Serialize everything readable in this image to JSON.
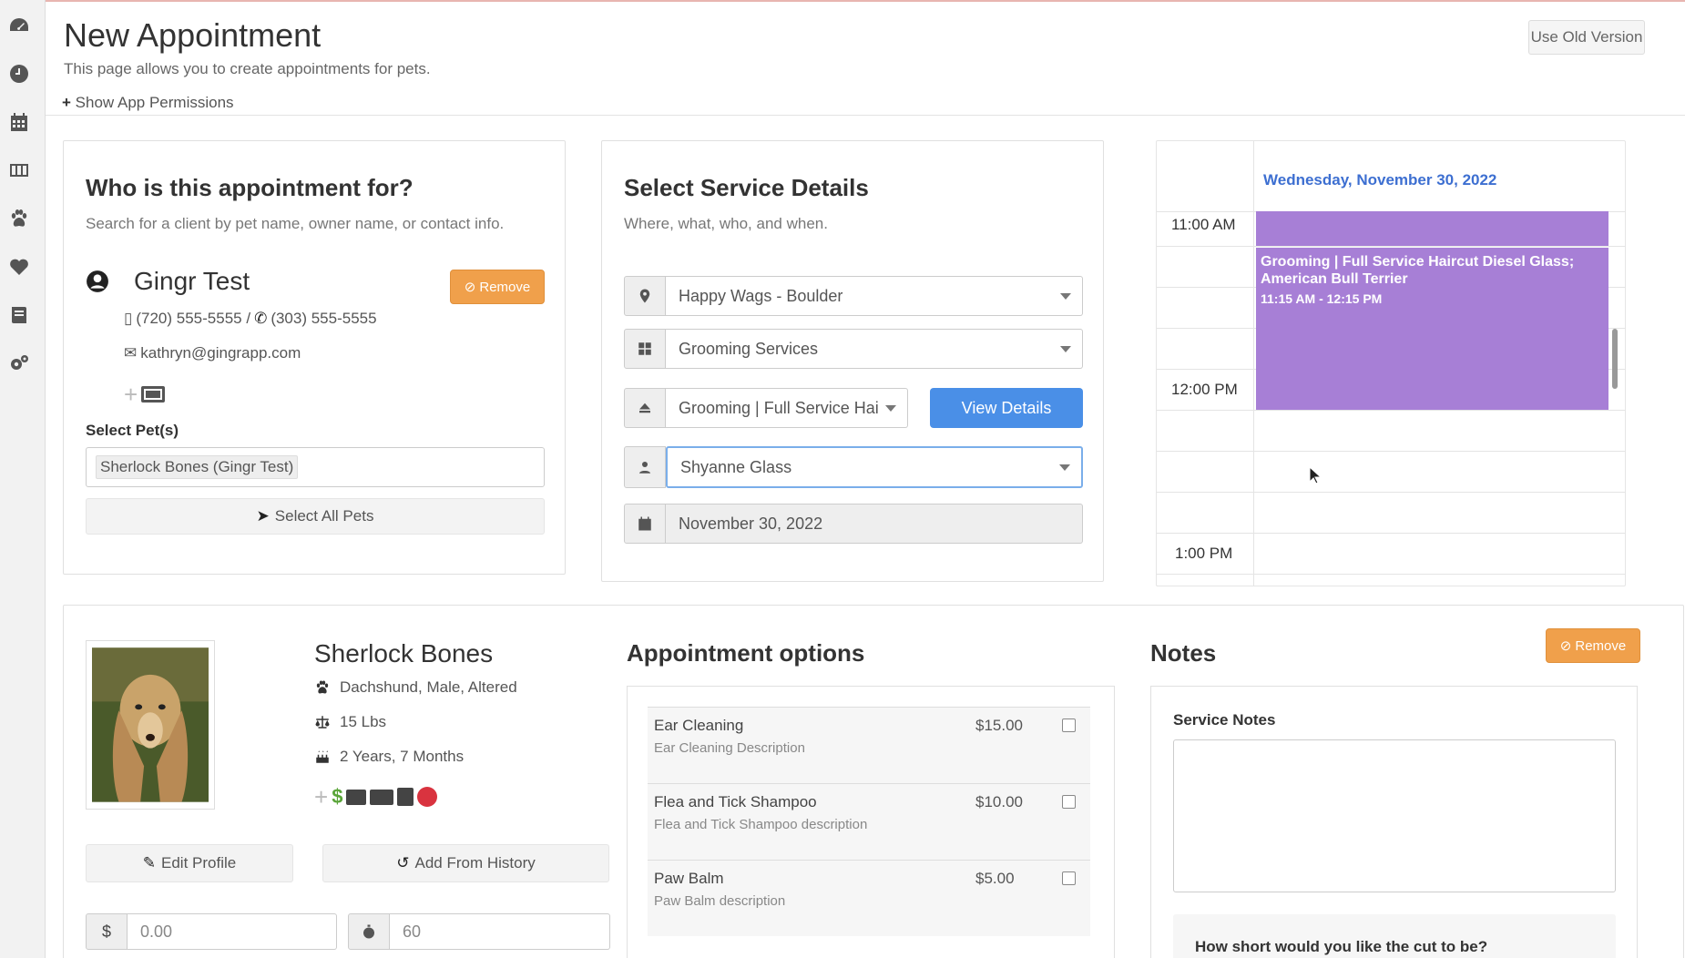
{
  "page": {
    "title": "New Appointment",
    "subtitle": "This page allows you to create appointments for pets.",
    "permissions_link": "Show App Permissions",
    "old_version_button": "Use Old Version"
  },
  "sidebar": {
    "icons": [
      "dashboard-icon",
      "clock-icon",
      "calendar-icon",
      "grid-icon",
      "paw-icon",
      "heart-icon",
      "book-icon",
      "gears-icon"
    ]
  },
  "client": {
    "heading": "Who is this appointment for?",
    "hint": "Search for a client by pet name, owner name, or contact info.",
    "name": "Gingr Test",
    "remove_label": "Remove",
    "phones": "(720) 555-5555 / ",
    "phone2": "(303) 555-5555",
    "email": "kathryn@gingrapp.com",
    "select_pets_label": "Select Pet(s)",
    "selected_pet": "Sherlock Bones (Gingr Test)",
    "select_all_label": "Select All Pets"
  },
  "service": {
    "heading": "Select Service Details",
    "hint": "Where, what, who, and when.",
    "location": "Happy Wags - Boulder",
    "category": "Grooming Services",
    "service": "Grooming | Full Service Hai",
    "view_details_label": "View Details",
    "staff": "Shyanne Glass",
    "date": "November 30, 2022"
  },
  "calendar": {
    "date_header": "Wednesday, November 30, 2022",
    "times": [
      "11:00 AM",
      "12:00 PM",
      "1:00 PM"
    ],
    "event_title": "Grooming | Full Service Haircut Diesel Glass; American Bull Terrier",
    "event_time": "11:15 AM - 12:15 PM",
    "event_color": "#a77fd6"
  },
  "pet": {
    "name": "Sherlock Bones",
    "breed": "Dachshund, Male, Altered",
    "weight": "15 Lbs",
    "age": "2 Years, 7 Months",
    "edit_profile_label": "Edit Profile",
    "add_history_label": "Add From History",
    "price_value": "0.00",
    "duration_value": "60"
  },
  "options": {
    "heading": "Appointment options",
    "items": [
      {
        "name": "Ear Cleaning",
        "desc": "Ear Cleaning Description",
        "price": "$15.00"
      },
      {
        "name": "Flea and Tick Shampoo",
        "desc": "Flea and Tick Shampoo description",
        "price": "$10.00"
      },
      {
        "name": "Paw Balm",
        "desc": "Paw Balm description",
        "price": "$5.00"
      }
    ]
  },
  "notes": {
    "heading": "Notes",
    "remove_label": "Remove",
    "service_notes_label": "Service Notes",
    "question": "How short would you like the cut to be?"
  },
  "colors": {
    "accent_blue": "#4a8fe7",
    "orange": "#f0a04b",
    "event_purple": "#a77fd6"
  }
}
